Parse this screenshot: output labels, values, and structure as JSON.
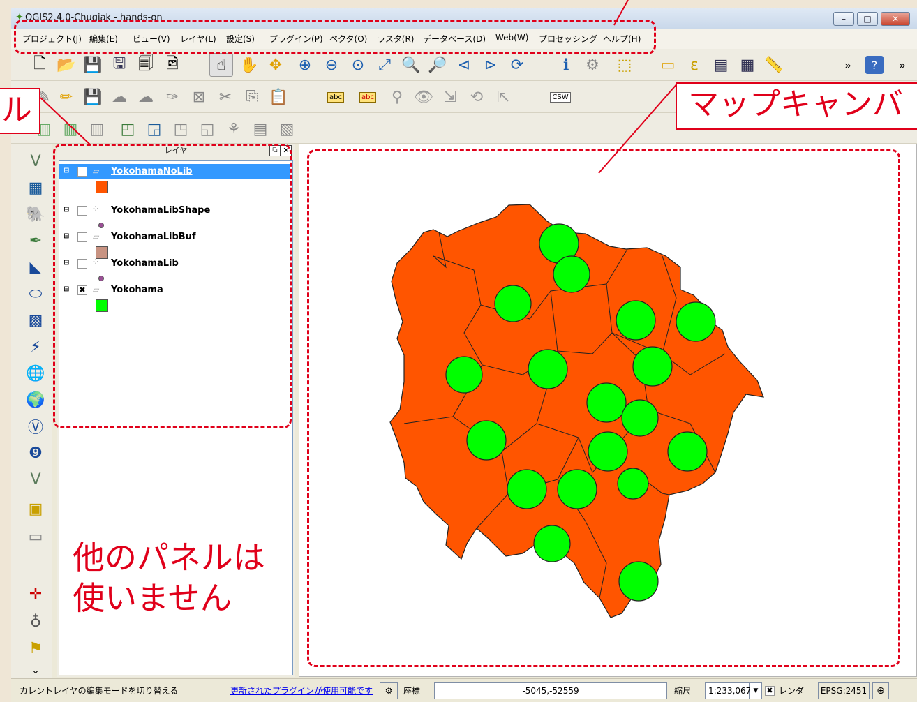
{
  "window": {
    "title": "QGIS2.4.0-Chugiak - hands-on",
    "controls": [
      "–",
      "□",
      "✕"
    ]
  },
  "menu": [
    "プロジェクト(J)",
    "編集(E)",
    "ビュー(V)",
    "レイヤ(L)",
    "設定(S)",
    "プラグイン(P)",
    "ベクタ(O)",
    "ラスタ(R)",
    "データベース(D)",
    "Web(W)",
    "プロセッシング",
    "ヘルプ(H)"
  ],
  "toolbar": {
    "overflow": "»",
    "help": "?",
    "csw": "CSW",
    "abc": "abc"
  },
  "layers_panel": {
    "title": "レイヤ",
    "layers": [
      {
        "name": "YokohamaNoLib",
        "checked": true,
        "selected": true,
        "swatch": "#ff5500",
        "symbol": "polygon"
      },
      {
        "name": "YokohamaLibShape",
        "checked": false,
        "selected": false,
        "swatch": "#9b4f96",
        "symbol": "point"
      },
      {
        "name": "YokohamaLibBuf",
        "checked": false,
        "selected": false,
        "swatch": "#c89382",
        "symbol": "polygon"
      },
      {
        "name": "YokohamaLib",
        "checked": false,
        "selected": false,
        "swatch": "#9b4f96",
        "symbol": "point"
      },
      {
        "name": "Yokohama",
        "checked": true,
        "selected": false,
        "swatch": "#00ff00",
        "symbol": "polygon"
      }
    ]
  },
  "annotations": {
    "map_canvas_label": "マップキャンバ",
    "layer_panel_label": "ル",
    "other_panels_note": "他のパネルは\n使いません"
  },
  "statusbar": {
    "message": "カレントレイヤの編集モードを切り替える",
    "plugin_link": "更新されたプラグインが使用可能です",
    "coord_label": "座標",
    "coord_value": "-5045,-52559",
    "scale_label": "縮尺",
    "scale_value": "1:233,067",
    "render_label": "レンダ",
    "crs": "EPSG:2451"
  },
  "colors": {
    "map_fill": "#ff5500",
    "buffer_fill": "#00ff00",
    "annotation": "#e0001a"
  }
}
